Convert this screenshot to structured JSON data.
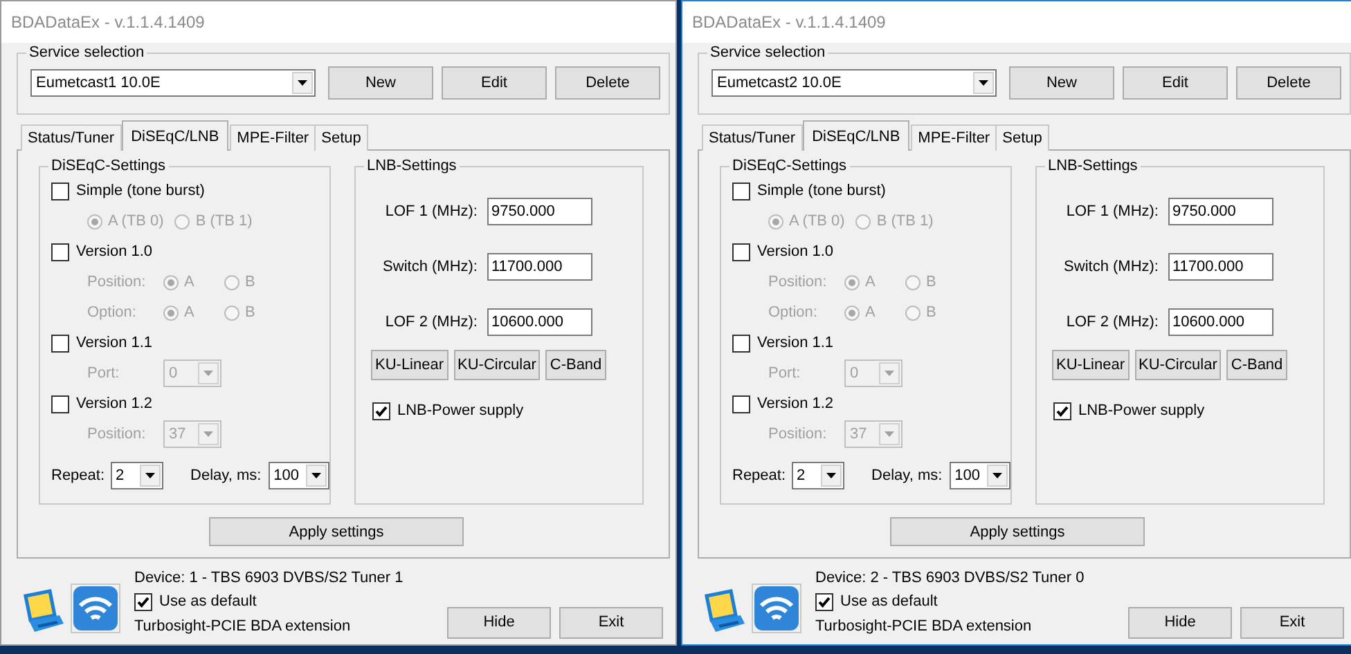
{
  "windows": [
    {
      "title": "BDADataEx - v.1.1.4.1409",
      "active": false,
      "service": {
        "legend": "Service selection",
        "value": "Eumetcast1 10.0E",
        "buttons": [
          "New",
          "Edit",
          "Delete"
        ]
      },
      "tabs": [
        {
          "label": "Status/Tuner",
          "selected": false
        },
        {
          "label": "DiSEqC/LNB",
          "selected": true
        },
        {
          "label": "MPE-Filter",
          "selected": false
        },
        {
          "label": "Setup",
          "selected": false
        }
      ],
      "diseqc": {
        "legend": "DiSEqC-Settings",
        "sections": [
          {
            "label": "Simple (tone burst)",
            "checked": false,
            "rows": [
              {
                "kind": "radios",
                "options": [
                  {
                    "label": "A (TB 0)",
                    "selected": true
                  },
                  {
                    "label": "B (TB 1)",
                    "selected": false
                  }
                ]
              }
            ]
          },
          {
            "label": "Version 1.0",
            "checked": false,
            "rows": [
              {
                "kind": "radios",
                "label": "Position:",
                "options": [
                  {
                    "label": "A",
                    "selected": true
                  },
                  {
                    "label": "B",
                    "selected": false
                  }
                ]
              },
              {
                "kind": "radios",
                "label": "Option:",
                "options": [
                  {
                    "label": "A",
                    "selected": true
                  },
                  {
                    "label": "B",
                    "selected": false
                  }
                ]
              }
            ]
          },
          {
            "label": "Version 1.1",
            "checked": false,
            "rows": [
              {
                "kind": "select",
                "label": "Port:",
                "value": "0"
              }
            ]
          },
          {
            "label": "Version 1.2",
            "checked": false,
            "rows": [
              {
                "kind": "select",
                "label": "Position:",
                "value": "37"
              }
            ]
          }
        ],
        "repeat": {
          "label": "Repeat:",
          "value": "2"
        },
        "delay": {
          "label": "Delay, ms:",
          "value": "100"
        }
      },
      "lnb": {
        "legend": "LNB-Settings",
        "fields": [
          {
            "label": "LOF 1 (MHz):",
            "value": "9750.000"
          },
          {
            "label": "Switch (MHz):",
            "value": "11700.000"
          },
          {
            "label": "LOF 2 (MHz):",
            "value": "10600.000"
          }
        ],
        "presets": [
          "KU-Linear",
          "KU-Circular",
          "C-Band"
        ],
        "power": {
          "label": "LNB-Power supply",
          "checked": true
        }
      },
      "apply": "Apply settings",
      "device": "Device: 1 - TBS 6903 DVBS/S2 Tuner 1",
      "use_default": {
        "label": "Use as default",
        "checked": true
      },
      "extension": "Turbosight-PCIE BDA extension",
      "buttons": [
        "Hide",
        "Exit"
      ]
    },
    {
      "title": "BDADataEx - v.1.1.4.1409",
      "active": true,
      "service": {
        "legend": "Service selection",
        "value": "Eumetcast2 10.0E",
        "buttons": [
          "New",
          "Edit",
          "Delete"
        ]
      },
      "tabs": [
        {
          "label": "Status/Tuner",
          "selected": false
        },
        {
          "label": "DiSEqC/LNB",
          "selected": true
        },
        {
          "label": "MPE-Filter",
          "selected": false
        },
        {
          "label": "Setup",
          "selected": false
        }
      ],
      "diseqc": {
        "legend": "DiSEqC-Settings",
        "sections": [
          {
            "label": "Simple (tone burst)",
            "checked": false,
            "rows": [
              {
                "kind": "radios",
                "options": [
                  {
                    "label": "A (TB 0)",
                    "selected": true
                  },
                  {
                    "label": "B (TB 1)",
                    "selected": false
                  }
                ]
              }
            ]
          },
          {
            "label": "Version 1.0",
            "checked": false,
            "rows": [
              {
                "kind": "radios",
                "label": "Position:",
                "options": [
                  {
                    "label": "A",
                    "selected": true
                  },
                  {
                    "label": "B",
                    "selected": false
                  }
                ]
              },
              {
                "kind": "radios",
                "label": "Option:",
                "options": [
                  {
                    "label": "A",
                    "selected": true
                  },
                  {
                    "label": "B",
                    "selected": false
                  }
                ]
              }
            ]
          },
          {
            "label": "Version 1.1",
            "checked": false,
            "rows": [
              {
                "kind": "select",
                "label": "Port:",
                "value": "0"
              }
            ]
          },
          {
            "label": "Version 1.2",
            "checked": false,
            "rows": [
              {
                "kind": "select",
                "label": "Position:",
                "value": "37"
              }
            ]
          }
        ],
        "repeat": {
          "label": "Repeat:",
          "value": "2"
        },
        "delay": {
          "label": "Delay, ms:",
          "value": "100"
        }
      },
      "lnb": {
        "legend": "LNB-Settings",
        "fields": [
          {
            "label": "LOF 1 (MHz):",
            "value": "9750.000"
          },
          {
            "label": "Switch (MHz):",
            "value": "11700.000"
          },
          {
            "label": "LOF 2 (MHz):",
            "value": "10600.000"
          }
        ],
        "presets": [
          "KU-Linear",
          "KU-Circular",
          "C-Band"
        ],
        "power": {
          "label": "LNB-Power supply",
          "checked": true
        }
      },
      "apply": "Apply settings",
      "device": "Device: 2 - TBS 6903 DVBS/S2 Tuner 0",
      "use_default": {
        "label": "Use as default",
        "checked": true
      },
      "extension": "Turbosight-PCIE BDA extension",
      "buttons": [
        "Hide",
        "Exit"
      ]
    }
  ]
}
